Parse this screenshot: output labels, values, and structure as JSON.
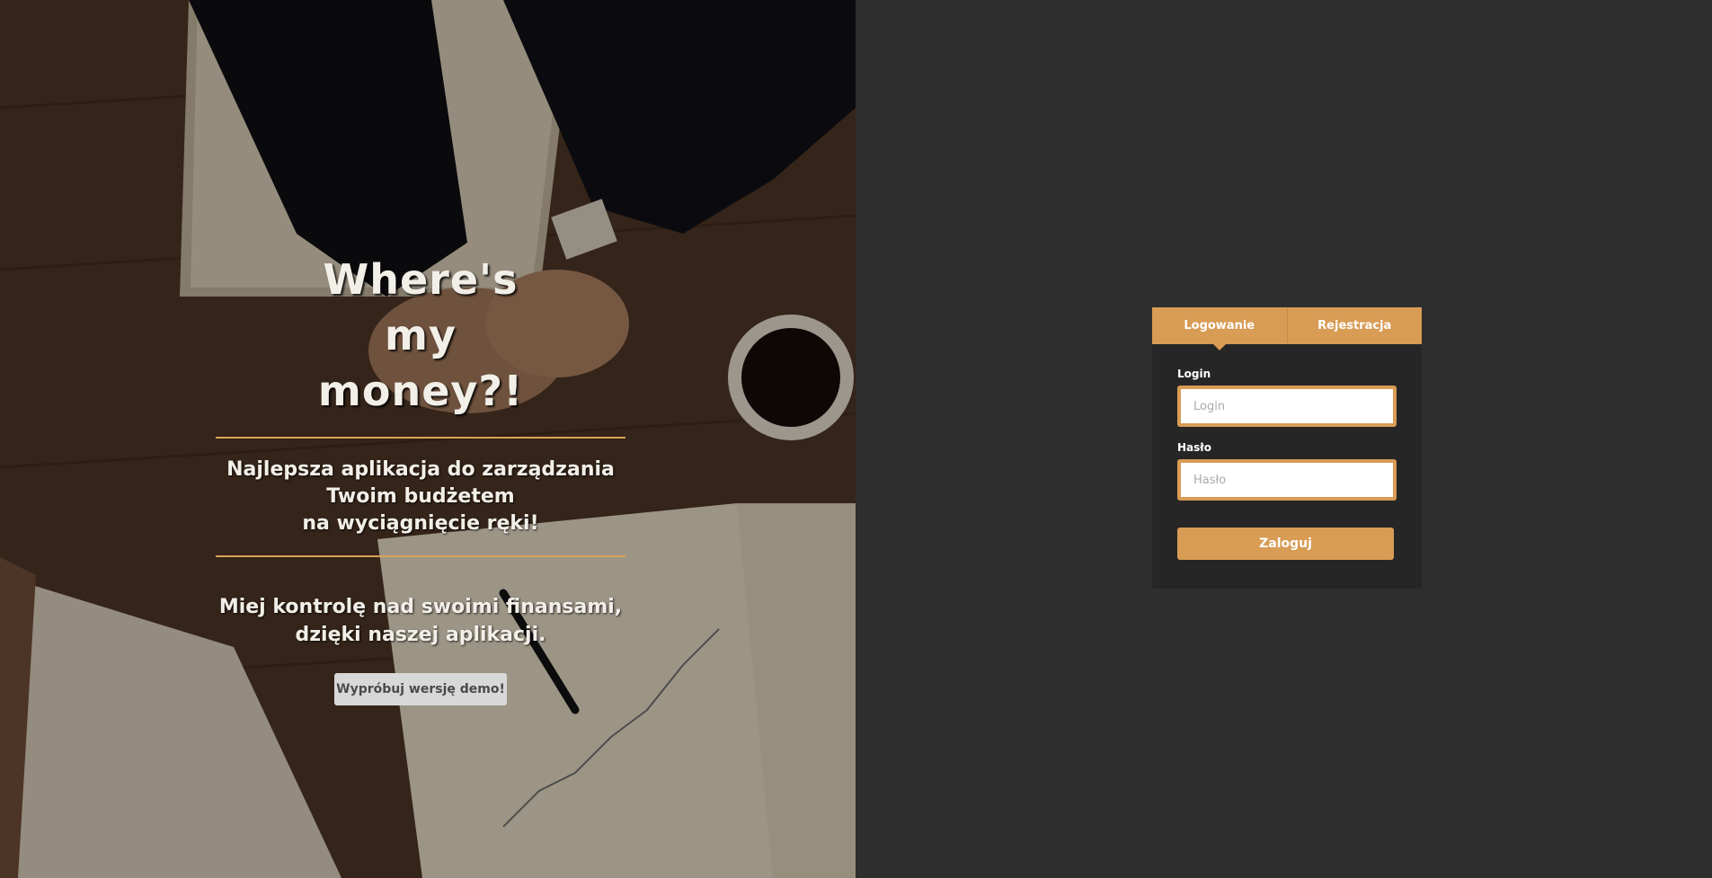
{
  "hero": {
    "title": "Where's my money?!",
    "subtitle_lines": [
      "Najlepsza aplikacja do zarządzania",
      "Twoim budżetem",
      "na wyciągnięcie ręki!"
    ],
    "lead_lines": [
      "Miej kontrolę nad swoimi finansami,",
      "dzięki naszej aplikacji."
    ],
    "demo_button": "Wypróbuj wersję demo!"
  },
  "auth": {
    "tabs": [
      {
        "label": "Logowanie",
        "active": true
      },
      {
        "label": "Rejestracja",
        "active": false
      }
    ],
    "login": {
      "label": "Login",
      "placeholder": "Login",
      "value": ""
    },
    "password": {
      "label": "Hasło",
      "placeholder": "Hasło",
      "value": ""
    },
    "submit": "Zaloguj"
  },
  "colors": {
    "accent": "#d89c55",
    "panel_bg": "#2e2e2e",
    "box_bg": "#262626"
  }
}
